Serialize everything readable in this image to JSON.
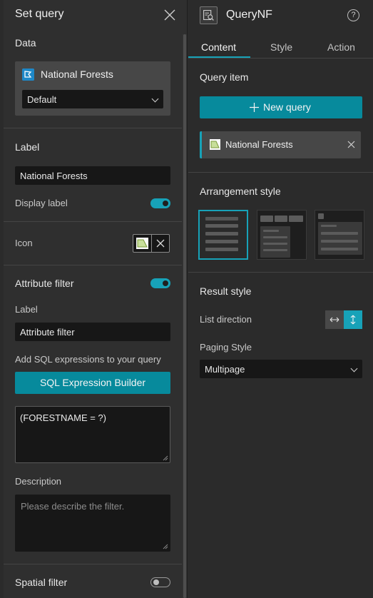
{
  "left_panel": {
    "title": "Set query",
    "data_section": {
      "title": "Data",
      "datasource_name": "National Forests",
      "view_select": "Default"
    },
    "label_section": {
      "title": "Label",
      "value": "National Forests",
      "display_label": "Display label",
      "display_label_on": true
    },
    "icon_section": {
      "title": "Icon"
    },
    "attribute_filter": {
      "title": "Attribute filter",
      "enabled": true,
      "label_title": "Label",
      "label_value": "Attribute filter",
      "sql_hint": "Add SQL expressions to your query",
      "sql_button": "SQL Expression Builder",
      "expression": "(FORESTNAME = ?)",
      "description_title": "Description",
      "description_placeholder": "Please describe the filter."
    },
    "spatial_filter": {
      "title": "Spatial filter",
      "enabled": false
    }
  },
  "right_panel": {
    "widget_name": "QueryNF",
    "help": "?",
    "tabs": [
      "Content",
      "Style",
      "Action"
    ],
    "active_tab": "Content",
    "query_item": {
      "title": "Query item",
      "new_query_button": "New query",
      "items": [
        "National Forests"
      ]
    },
    "arrangement": {
      "title": "Arrangement style",
      "selected_index": 0
    },
    "result_style": {
      "title": "Result style",
      "list_direction_label": "List direction",
      "list_direction_selected": "vertical",
      "paging_style_label": "Paging Style",
      "paging_style_value": "Multipage"
    }
  },
  "colors": {
    "accent": "#17a2b8",
    "button": "#078a9c",
    "panel": "#2f2f2f",
    "input": "#171717"
  }
}
